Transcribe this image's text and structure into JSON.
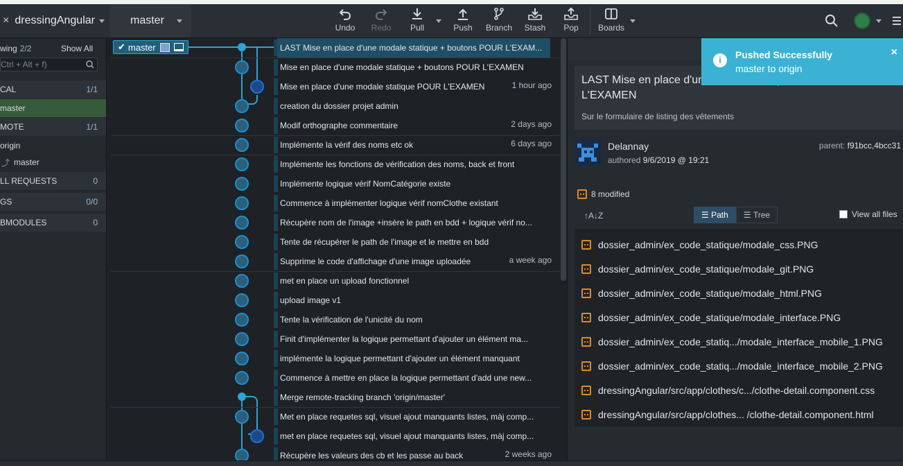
{
  "toolbar": {
    "repo": "dressingAngular",
    "branch": "master",
    "buttons": [
      {
        "label": "Undo"
      },
      {
        "label": "Redo"
      },
      {
        "label": "Pull"
      },
      {
        "label": "Push"
      },
      {
        "label": "Branch"
      },
      {
        "label": "Stash"
      },
      {
        "label": "Pop"
      },
      {
        "label": "Boards"
      }
    ]
  },
  "sidebar": {
    "viewing": "wing",
    "viewing_count": "2/2",
    "show_all": "Show All",
    "filter_placeholder": "Ctrl + Alt + f)",
    "local": {
      "label": "CAL",
      "count": "1/1"
    },
    "local_branch": "master",
    "remote": {
      "label": "MOTE",
      "count": "1/1"
    },
    "remote_origin": "origin",
    "remote_branch": "master",
    "pull_requests": {
      "label": "LL REQUESTS",
      "count": "0"
    },
    "tags": {
      "label": "GS",
      "count": "0/0"
    },
    "submodules": {
      "label": "BMODULES",
      "count": "0"
    }
  },
  "graph": {
    "branch_tag": "master",
    "commits": [
      {
        "msg": "LAST Mise en place d'une modale statique + boutons POUR L'EXAM...",
        "time": ""
      },
      {
        "msg": "Mise en place d'une modale statique + boutons POUR L'EXAMEN",
        "time": ""
      },
      {
        "msg": "Mise en place d'une modale statique POUR L'EXAMEN",
        "time": "1 hour ago"
      },
      {
        "msg": "creation du dossier projet admin",
        "time": ""
      },
      {
        "msg": "Modif orthographe commentaire",
        "time": "2 days ago"
      },
      {
        "msg": "Implémente la vérif des noms etc ok",
        "time": "6 days ago"
      },
      {
        "msg": "Implémente les fonctions de vérification des noms, back et front",
        "time": ""
      },
      {
        "msg": "Implémente logique vérif NomCatégorie existe",
        "time": ""
      },
      {
        "msg": "Commence à implémenter logique vérif nomClothe existant",
        "time": ""
      },
      {
        "msg": "Récupère nom de l'image +insère le path en bdd + logique vérif no...",
        "time": ""
      },
      {
        "msg": "Tente de récupérer le path de l'image et le mettre en bdd",
        "time": ""
      },
      {
        "msg": "Supprime le code d'affichage d'une image uploadée",
        "time": "a week ago"
      },
      {
        "msg": "met en place un upload fonctionnel",
        "time": ""
      },
      {
        "msg": "upload image v1",
        "time": ""
      },
      {
        "msg": "Tente la vérification de l'unicité du nom",
        "time": ""
      },
      {
        "msg": "Finit d'implémenter la logique permettant d'ajouter un élément ma...",
        "time": ""
      },
      {
        "msg": "implémente la logique permettant d'ajouter un élément manquant",
        "time": ""
      },
      {
        "msg": "Commence à mettre en place la logique permettant d'add une new...",
        "time": ""
      },
      {
        "msg": "Merge remote-tracking branch 'origin/master'",
        "time": ""
      },
      {
        "msg": "Met en place requetes sql, visuel ajout manquants listes, màj comp...",
        "time": ""
      },
      {
        "msg": "met en place requetes sql, visuel ajout manquants listes, màj comp...",
        "time": ""
      },
      {
        "msg": "Récupère les valeurs des cb et les passe au back",
        "time": "2 weeks ago"
      }
    ]
  },
  "detail": {
    "title": "LAST Mise en place d'une modale statique + boutons POUR L'EXAMEN",
    "description": "Sur le formulaire de listing des vêtements",
    "author": "Delannay",
    "authored_label": "authored",
    "authored_date": "9/6/2019 @ 19:21",
    "parent_label": "parent:",
    "parent_value": "f91bcc,4bcc31",
    "modified": "8 modified",
    "path_label": "Path",
    "tree_label": "Tree",
    "view_all": "View all files",
    "files": [
      "dossier_admin/ex_code_statique/modale_css.PNG",
      "dossier_admin/ex_code_statique/modale_git.PNG",
      "dossier_admin/ex_code_statique/modale_html.PNG",
      "dossier_admin/ex_code_statique/modale_interface.PNG",
      "dossier_admin/ex_code_statiq.../modale_interface_mobile_1.PNG",
      "dossier_admin/ex_code_statiq.../modale_interface_mobile_2.PNG",
      "dressingAngular/src/app/clothes/c.../clothe-detail.component.css",
      "dressingAngular/src/app/clothes... /clothe-detail.component.html"
    ]
  },
  "toast": {
    "title": "Pushed Successfully",
    "message": "master to origin",
    "close": "×",
    "icon_glyph": "i"
  }
}
